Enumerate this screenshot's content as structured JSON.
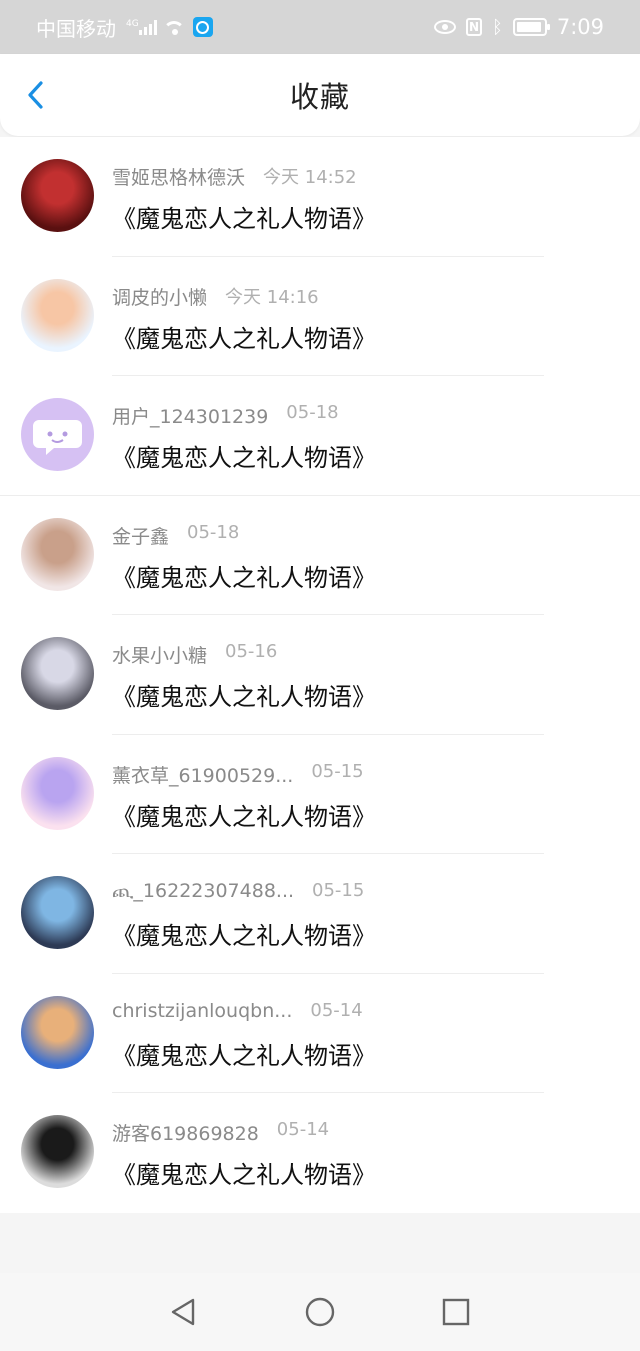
{
  "status_bar": {
    "carrier": "中国移动",
    "network": "4G",
    "time": "7:09",
    "icons": [
      "signal-icon",
      "wifi-icon",
      "app-notification-icon",
      "eye-icon",
      "nfc-icon",
      "bluetooth-icon",
      "battery-icon"
    ]
  },
  "header": {
    "title": "收藏",
    "back_icon": "chevron-left-icon",
    "accent": "#1a8fe3"
  },
  "favorites": [
    {
      "username": "雪姬思格林德沃",
      "time": "今天 14:52",
      "title": "《魔鬼恋人之礼人物语》",
      "avatar_colors": [
        "#5a1010",
        "#c23030"
      ]
    },
    {
      "username": "调皮的小懒",
      "time": "今天 14:16",
      "title": "《魔鬼恋人之礼人物语》",
      "avatar_colors": [
        "#eaf4ff",
        "#f7c6a5"
      ]
    },
    {
      "username": "用户_124301239",
      "time": "05-18",
      "title": "《魔鬼恋人之礼人物语》",
      "avatar_colors": [
        "#d6c1f3",
        "#ffffff"
      ]
    },
    {
      "username": "金子鑫",
      "time": "05-18",
      "title": "《魔鬼恋人之礼人物语》",
      "avatar_colors": [
        "#f1e6e6",
        "#c9a08a"
      ]
    },
    {
      "username": "水果小小糖",
      "time": "05-16",
      "title": "《魔鬼恋人之礼人物语》",
      "avatar_colors": [
        "#5b5b66",
        "#d8d8e6"
      ]
    },
    {
      "username": "薰衣草_61900529...",
      "time": "05-15",
      "title": "《魔鬼恋人之礼人物语》",
      "avatar_colors": [
        "#fbe1ef",
        "#b9a4f0"
      ]
    },
    {
      "username": "ጪ_16222307488...",
      "time": "05-15",
      "title": "《魔鬼恋人之礼人物语》",
      "avatar_colors": [
        "#2d3a55",
        "#7fb6e3"
      ]
    },
    {
      "username": "christzijanlouqbn...",
      "time": "05-14",
      "title": "《魔鬼恋人之礼人物语》",
      "avatar_colors": [
        "#3a6fd0",
        "#e8b07a"
      ]
    },
    {
      "username": "游客619869828",
      "time": "05-14",
      "title": "《魔鬼恋人之礼人物语》",
      "avatar_colors": [
        "#dcdcdc",
        "#1a1a1a"
      ]
    }
  ],
  "nav": {
    "back": "nav-back-triangle-icon",
    "home": "nav-home-circle-icon",
    "recents": "nav-recents-square-icon"
  }
}
